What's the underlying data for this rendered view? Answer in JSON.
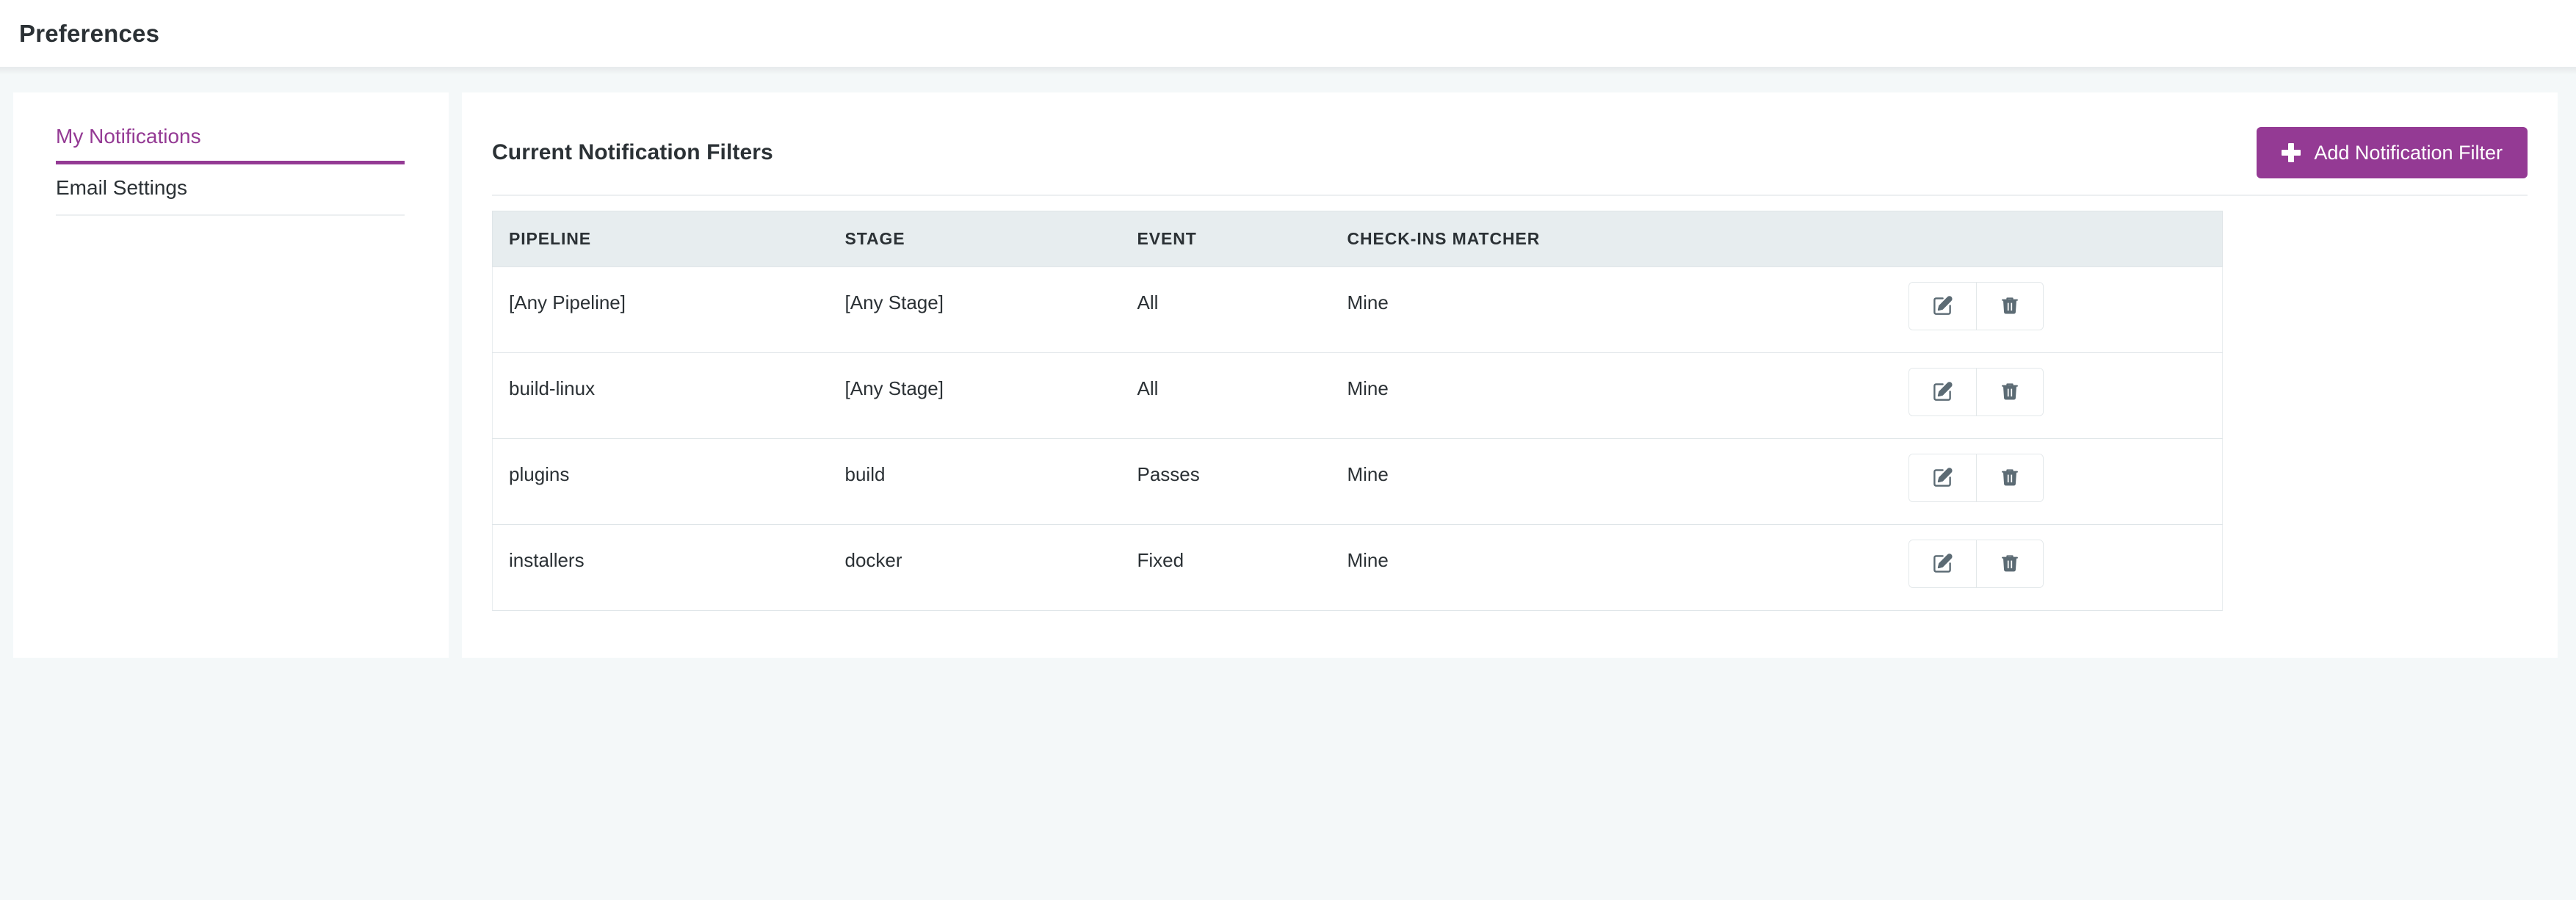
{
  "header": {
    "title": "Preferences"
  },
  "sidebar": {
    "items": [
      {
        "label": "My Notifications",
        "active": true
      },
      {
        "label": "Email Settings",
        "active": false
      }
    ]
  },
  "main": {
    "title": "Current Notification Filters",
    "add_button": {
      "label": "Add Notification Filter",
      "icon": "plus-icon",
      "color": "#943a94"
    },
    "table": {
      "columns": [
        "PIPELINE",
        "STAGE",
        "EVENT",
        "CHECK-INS MATCHER",
        ""
      ],
      "rows": [
        {
          "pipeline": "[Any Pipeline]",
          "stage": "[Any Stage]",
          "event": "All",
          "matcher": "Mine",
          "actions": [
            "edit-icon",
            "trash-icon"
          ]
        },
        {
          "pipeline": "build-linux",
          "stage": "[Any Stage]",
          "event": "All",
          "matcher": "Mine",
          "actions": [
            "edit-icon",
            "trash-icon"
          ]
        },
        {
          "pipeline": "plugins",
          "stage": "build",
          "event": "Passes",
          "matcher": "Mine",
          "actions": [
            "edit-icon",
            "trash-icon"
          ]
        },
        {
          "pipeline": "installers",
          "stage": "docker",
          "event": "Fixed",
          "matcher": "Mine",
          "actions": [
            "edit-icon",
            "trash-icon"
          ]
        }
      ]
    }
  },
  "colors": {
    "accent": "#943a94",
    "page_background": "#f4f8f9",
    "panel_background": "#ffffff",
    "table_header_background": "#e7edef",
    "icon": "#5c6b74"
  }
}
